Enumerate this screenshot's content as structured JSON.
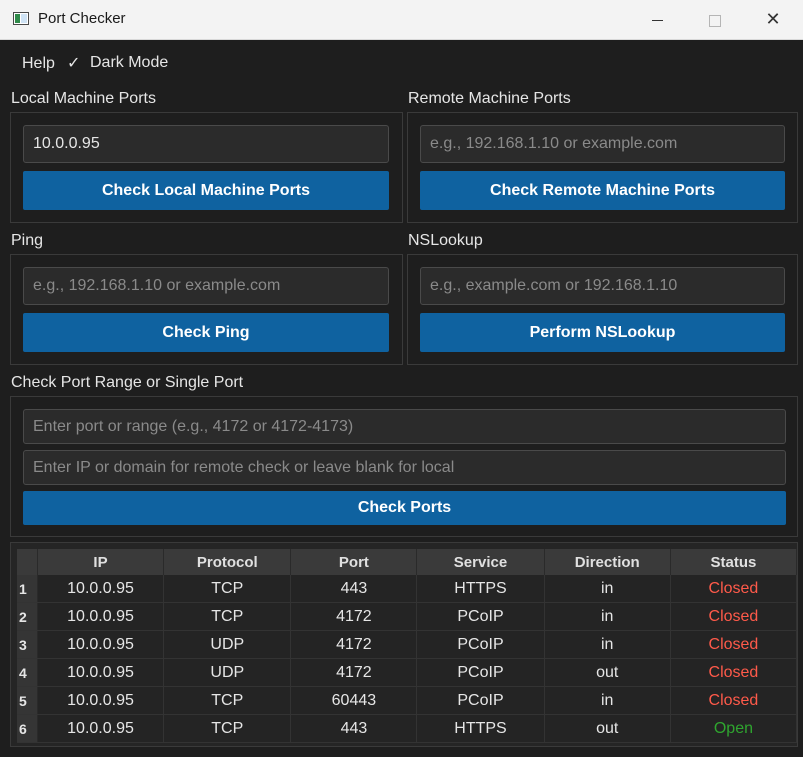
{
  "window": {
    "title": "Port Checker",
    "minimize": "—",
    "maximize": "☐",
    "close": "✕"
  },
  "menu": {
    "help": "Help",
    "dark_mode_check": "✓",
    "dark_mode": "Dark Mode"
  },
  "local": {
    "label": "Local Machine Ports",
    "input_value": "10.0.0.95",
    "button": "Check Local Machine Ports"
  },
  "remote": {
    "label": "Remote Machine Ports",
    "placeholder": "e.g., 192.168.1.10 or example.com",
    "button": "Check Remote Machine Ports"
  },
  "ping": {
    "label": "Ping",
    "placeholder": "e.g., 192.168.1.10 or example.com",
    "button": "Check Ping"
  },
  "nslookup": {
    "label": "NSLookup",
    "placeholder": "e.g., example.com or 192.168.1.10",
    "button": "Perform NSLookup"
  },
  "range": {
    "label": "Check Port Range or Single Port",
    "port_placeholder": "Enter port or range (e.g., 4172 or 4172-4173)",
    "ip_placeholder": "Enter IP or domain for remote check or leave blank for local",
    "button": "Check Ports"
  },
  "table": {
    "headers": [
      "IP",
      "Protocol",
      "Port",
      "Service",
      "Direction",
      "Status"
    ],
    "rows": [
      {
        "num": "1",
        "ip": "10.0.0.95",
        "protocol": "TCP",
        "port": "443",
        "service": "HTTPS",
        "direction": "in",
        "status": "Closed"
      },
      {
        "num": "2",
        "ip": "10.0.0.95",
        "protocol": "TCP",
        "port": "4172",
        "service": "PCoIP",
        "direction": "in",
        "status": "Closed"
      },
      {
        "num": "3",
        "ip": "10.0.0.95",
        "protocol": "UDP",
        "port": "4172",
        "service": "PCoIP",
        "direction": "in",
        "status": "Closed"
      },
      {
        "num": "4",
        "ip": "10.0.0.95",
        "protocol": "UDP",
        "port": "4172",
        "service": "PCoIP",
        "direction": "out",
        "status": "Closed"
      },
      {
        "num": "5",
        "ip": "10.0.0.95",
        "protocol": "TCP",
        "port": "60443",
        "service": "PCoIP",
        "direction": "in",
        "status": "Closed"
      },
      {
        "num": "6",
        "ip": "10.0.0.95",
        "protocol": "TCP",
        "port": "443",
        "service": "HTTPS",
        "direction": "out",
        "status": "Open"
      }
    ]
  },
  "colors": {
    "button": "#0f62a0",
    "closed": "#ff5a4a",
    "open": "#2fa52f",
    "background": "#1e1e1e"
  }
}
